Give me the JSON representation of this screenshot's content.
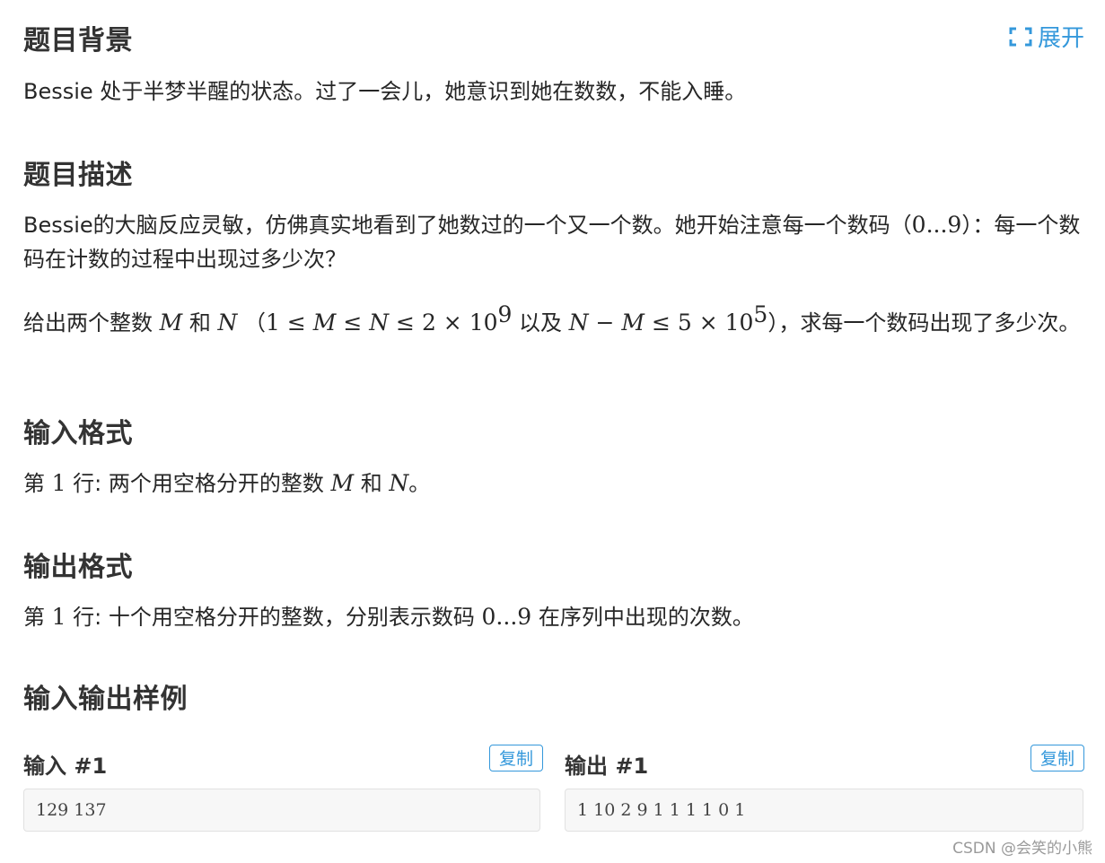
{
  "expand": {
    "label": "展开"
  },
  "background": {
    "heading": "题目背景",
    "text": "Bessie 处于半梦半醒的状态。过了一会儿，她意识到她在数数，不能入睡。"
  },
  "description": {
    "heading": "题目描述",
    "p1_a": "Bessie的大脑反应灵敏，仿佛真实地看到了她数过的一个又一个数。她开始注意每一个数码（",
    "p1_math": "0...9",
    "p1_b": "）：每一个数码在计数的过程中出现过多少次？",
    "p2_a": "给出两个整数 ",
    "p2_M": "M",
    "p2_and": " 和 ",
    "p2_N": "N",
    "p2_b": " （",
    "p2_c1": "1 ≤ ",
    "p2_c2": " ≤ ",
    "p2_c3": " ≤ 2 × 10",
    "p2_exp1": "9",
    "p2_d": " 以及 ",
    "p2_e1": " − ",
    "p2_e2": " ≤ 5 × 10",
    "p2_exp2": "5",
    "p2_f": "），求每一个数码出现了多少次。"
  },
  "input_format": {
    "heading": "输入格式",
    "a": "第 ",
    "line": "1",
    "b": " 行: 两个用空格分开的整数 ",
    "M": "M",
    "and": " 和 ",
    "N": "N",
    "end": "。"
  },
  "output_format": {
    "heading": "输出格式",
    "a": "第 ",
    "line": "1",
    "b": " 行: 十个用空格分开的整数，分别表示数码 ",
    "range": "0...9",
    "c": " 在序列中出现的次数。"
  },
  "samples": {
    "heading": "输入输出样例",
    "input_label": "输入 #1",
    "output_label": "输出 #1",
    "copy_label": "复制",
    "input_value": "129 137",
    "output_value": "1 10 2 9 1 1 1 1 0 1"
  },
  "watermark": "CSDN @会笑的小熊",
  "colors": {
    "accent": "#3498db",
    "heading": "#333333",
    "text": "#262626"
  }
}
